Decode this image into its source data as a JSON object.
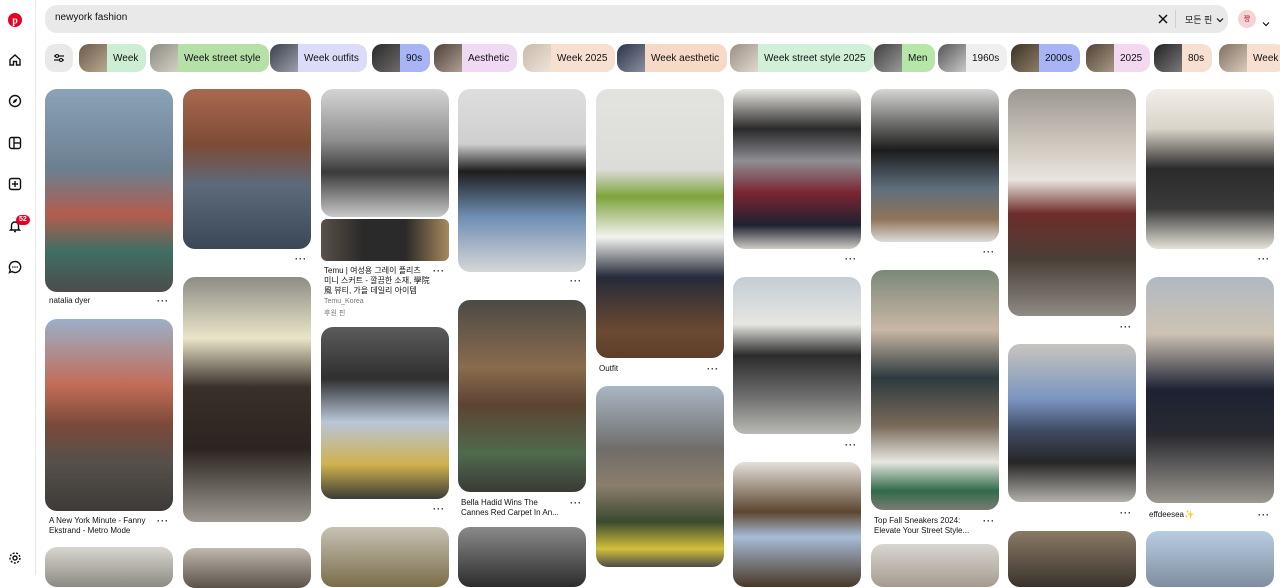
{
  "search": {
    "value": "newyork fashion",
    "scope_label": "모든 핀"
  },
  "account": {
    "avatar_initial": "쨩"
  },
  "sidebar": {
    "notification_count": "52"
  },
  "colors": {
    "brand": "#e60023"
  },
  "chips": [
    {
      "label": "Week",
      "bg": "#cdeed3"
    },
    {
      "label": "Week street style",
      "bg": "#b5e0a8"
    },
    {
      "label": "Week outfits",
      "bg": "#dcdcf8"
    },
    {
      "label": "90s",
      "bg": "#a8b4f5"
    },
    {
      "label": "Aesthetic",
      "bg": "#efd9f3"
    },
    {
      "label": "Week 2025",
      "bg": "#f7e0d2"
    },
    {
      "label": "Week aesthetic",
      "bg": "#f6d9c6"
    },
    {
      "label": "Week street style 2025",
      "bg": "#d2f0d8"
    },
    {
      "label": "Men",
      "bg": "#b6e7a8"
    },
    {
      "label": "1960s",
      "bg": "#efefef"
    },
    {
      "label": "2000s",
      "bg": "#a8b4f5"
    },
    {
      "label": "2025",
      "bg": "#f3d9f0"
    },
    {
      "label": "80s",
      "bg": "#f7e0d2"
    },
    {
      "label": "Week",
      "bg": "#f7e0d2"
    }
  ],
  "pins": {
    "p1": "natalia dyer",
    "p2": "A New York Minute - Fanny Ekstrand - Metro Mode",
    "p3": "Temu | 여성용 그레이 플리츠 미니 스커트 - 깔끔한 소재, 學院風 뷰티, 가을 데일리 아이템",
    "p3b": "Temu_Korea",
    "p3c": "후원 핀",
    "p4": "Bella Hadid Wins The Cannes Red Carpet In An...",
    "p5": "Outfit",
    "p6": "Top Fall Sneakers 2024: Elevate Your Street Style...",
    "p7": "effdeesea✨"
  }
}
